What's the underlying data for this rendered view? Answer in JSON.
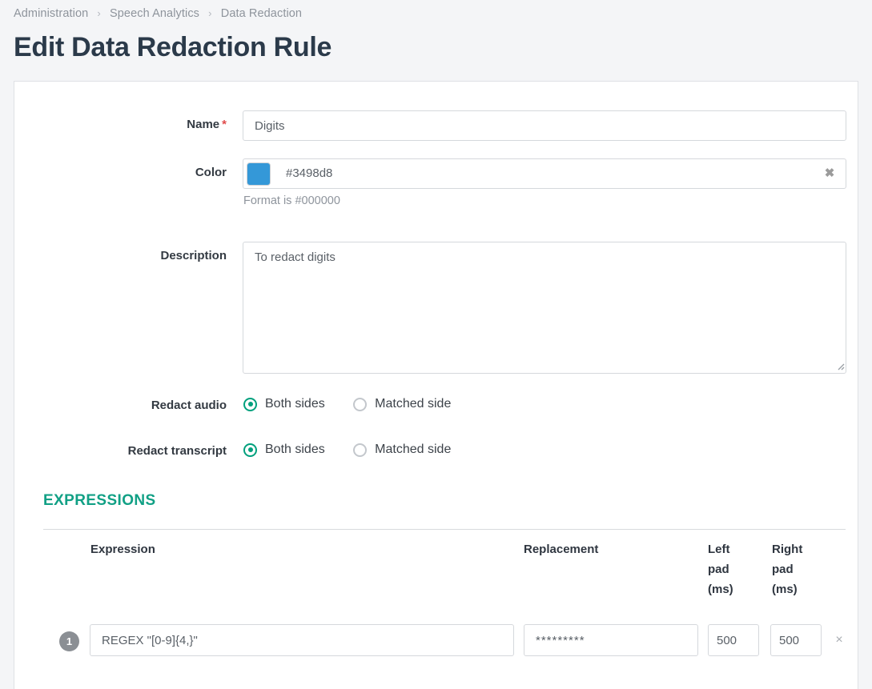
{
  "breadcrumb": {
    "items": [
      "Administration",
      "Speech Analytics",
      "Data Redaction"
    ],
    "separator": "›"
  },
  "page": {
    "title": "Edit Data Redaction Rule"
  },
  "form": {
    "name": {
      "label": "Name",
      "required_marker": "*",
      "value": "Digits",
      "placeholder": "Digits"
    },
    "color": {
      "label": "Color",
      "value": "#3498d8",
      "swatch_hex": "#3498d8",
      "hint": "Format is #000000",
      "clear_icon": "✖"
    },
    "description": {
      "label": "Description",
      "value": "To redact digits",
      "placeholder": "To redact digits"
    },
    "redact_audio": {
      "label": "Redact audio",
      "options": [
        "Both sides",
        "Matched side"
      ],
      "selected": "Both sides"
    },
    "redact_transcript": {
      "label": "Redact transcript",
      "options": [
        "Both sides",
        "Matched side"
      ],
      "selected": "Both sides"
    }
  },
  "expressions": {
    "section_title": "EXPRESSIONS",
    "columns": {
      "expression": "Expression",
      "replacement": "Replacement",
      "left_pad": "Left pad (ms)",
      "right_pad": "Right pad (ms)"
    },
    "rows": [
      {
        "index": "1",
        "expression": "REGEX \"[0-9]{4,}\"",
        "replacement": "*********",
        "left_pad": "500",
        "right_pad": "500",
        "remove_icon": "×"
      }
    ]
  },
  "colors": {
    "accent_teal": "#11a085",
    "radio_selected": "#00a07d",
    "title": "#2b3a4a",
    "breadcrumb": "#8e949c",
    "required": "#e04b4b"
  }
}
